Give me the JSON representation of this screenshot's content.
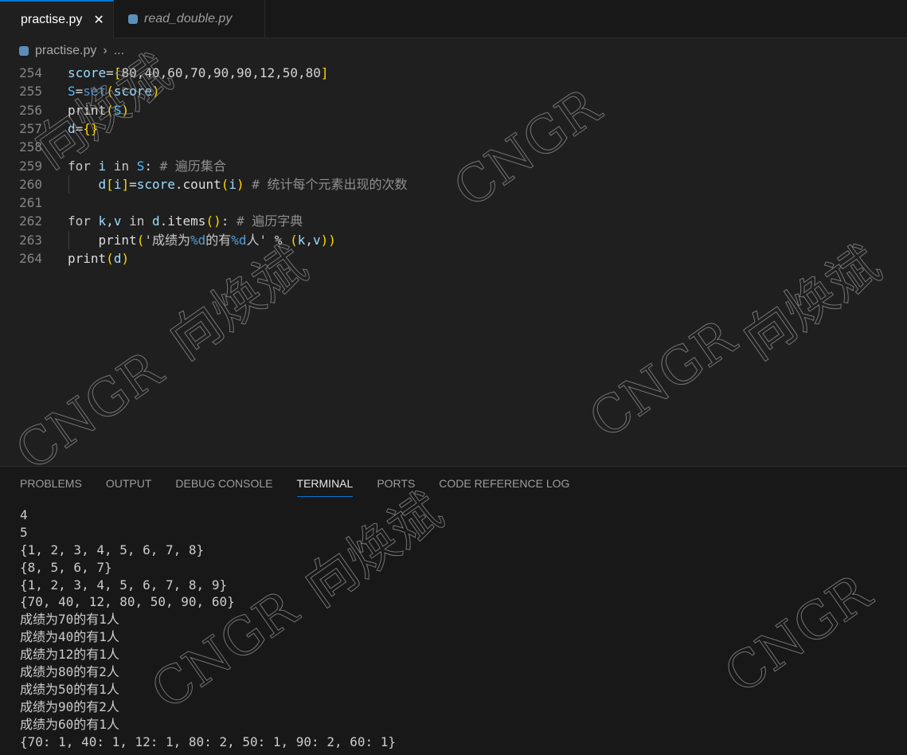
{
  "tabs": [
    {
      "label": "practise.py",
      "active": true
    },
    {
      "label": "read_double.py",
      "active": false
    }
  ],
  "close_glyph": "✕",
  "breadcrumb": {
    "file": "practise.py",
    "sep": "›",
    "rest": "..."
  },
  "code_lines": [
    {
      "n": "254",
      "indent": false,
      "tokens": [
        [
          "score",
          "var"
        ],
        [
          "=",
          "op"
        ],
        [
          "[",
          "br"
        ],
        [
          "80,40,60,70,90,90,12,50,80",
          "num"
        ],
        [
          "]",
          "br"
        ]
      ]
    },
    {
      "n": "255",
      "indent": false,
      "tokens": [
        [
          "S",
          "cls"
        ],
        [
          "=",
          "op"
        ],
        [
          "set",
          "bt"
        ],
        [
          "(",
          "br"
        ],
        [
          "score",
          "var"
        ],
        [
          ")",
          "br"
        ]
      ]
    },
    {
      "n": "256",
      "indent": false,
      "tokens": [
        [
          "print",
          "fn"
        ],
        [
          "(",
          "br"
        ],
        [
          "S",
          "cls"
        ],
        [
          ")",
          "br"
        ]
      ]
    },
    {
      "n": "257",
      "indent": false,
      "tokens": [
        [
          "d",
          "var"
        ],
        [
          "=",
          "op"
        ],
        [
          "{}",
          "br"
        ]
      ]
    },
    {
      "n": "258",
      "indent": false,
      "tokens": []
    },
    {
      "n": "259",
      "indent": false,
      "tokens": [
        [
          "for ",
          "kw"
        ],
        [
          "i",
          "var"
        ],
        [
          " in ",
          "kw"
        ],
        [
          "S",
          "cls"
        ],
        [
          ": ",
          "op"
        ],
        [
          "# 遍历集合",
          "cm"
        ]
      ]
    },
    {
      "n": "260",
      "indent": true,
      "tokens": [
        [
          "    d",
          "var"
        ],
        [
          "[",
          "br"
        ],
        [
          "i",
          "var"
        ],
        [
          "]",
          "br"
        ],
        [
          "=",
          "op"
        ],
        [
          "score",
          "var"
        ],
        [
          ".",
          "op"
        ],
        [
          "count",
          "fn"
        ],
        [
          "(",
          "br"
        ],
        [
          "i",
          "var"
        ],
        [
          ")",
          "br"
        ],
        [
          " # 统计每个元素出现的次数",
          "cm"
        ]
      ]
    },
    {
      "n": "261",
      "indent": false,
      "tokens": []
    },
    {
      "n": "262",
      "indent": false,
      "tokens": [
        [
          "for ",
          "kw"
        ],
        [
          "k",
          "var"
        ],
        [
          ",",
          "op"
        ],
        [
          "v",
          "var"
        ],
        [
          " in ",
          "kw"
        ],
        [
          "d",
          "var"
        ],
        [
          ".",
          "op"
        ],
        [
          "items",
          "fn"
        ],
        [
          "()",
          "br"
        ],
        [
          ": ",
          "op"
        ],
        [
          "# 遍历字典",
          "cm"
        ]
      ]
    },
    {
      "n": "263",
      "indent": true,
      "tokens": [
        [
          "    print",
          "fn"
        ],
        [
          "(",
          "br"
        ],
        [
          "'成绩为",
          "str"
        ],
        [
          "%d",
          "fmt"
        ],
        [
          "的有",
          "str"
        ],
        [
          "%d",
          "fmt"
        ],
        [
          "人'",
          "str"
        ],
        [
          " % ",
          "op"
        ],
        [
          "(",
          "br"
        ],
        [
          "k",
          "var"
        ],
        [
          ",",
          "op"
        ],
        [
          "v",
          "var"
        ],
        [
          ")",
          "br"
        ],
        [
          ")",
          "br"
        ]
      ]
    },
    {
      "n": "264",
      "indent": false,
      "tokens": [
        [
          "print",
          "fn"
        ],
        [
          "(",
          "br"
        ],
        [
          "d",
          "var"
        ],
        [
          ")",
          "br"
        ]
      ]
    }
  ],
  "panel_tabs": [
    {
      "label": "PROBLEMS"
    },
    {
      "label": "OUTPUT"
    },
    {
      "label": "DEBUG CONSOLE"
    },
    {
      "label": "TERMINAL",
      "active": true
    },
    {
      "label": "PORTS"
    },
    {
      "label": "CODE REFERENCE LOG"
    }
  ],
  "terminal_lines": [
    "4",
    "5",
    "{1, 2, 3, 4, 5, 6, 7, 8}",
    "{8, 5, 6, 7}",
    "{1, 2, 3, 4, 5, 6, 7, 8, 9}",
    "{70, 40, 12, 80, 50, 90, 60}",
    "成绩为70的有1人",
    "成绩为40的有1人",
    "成绩为12的有1人",
    "成绩为80的有2人",
    "成绩为50的有1人",
    "成绩为90的有2人",
    "成绩为60的有1人",
    "{70: 1, 40: 1, 12: 1, 80: 2, 50: 1, 90: 2, 60: 1}"
  ],
  "watermarks": [
    "向焕斌",
    "CNGR"
  ]
}
